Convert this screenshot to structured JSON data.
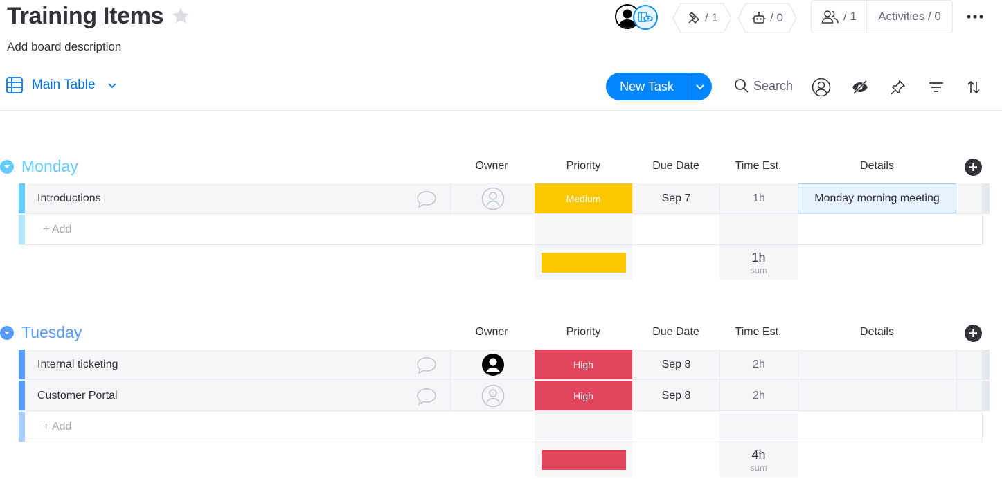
{
  "board": {
    "title": "Training Items",
    "description": "Add board description",
    "integrations_count": "/ 1",
    "automations_count": "/ 0",
    "members_count": "/ 1",
    "activities_label": "Activities / 0"
  },
  "toolbar": {
    "view_label": "Main Table",
    "new_task_label": "New Task",
    "search_label": "Search"
  },
  "columns": {
    "owner": "Owner",
    "priority": "Priority",
    "due_date": "Due Date",
    "time_est": "Time Est.",
    "details": "Details"
  },
  "groups": [
    {
      "name": "Monday",
      "color": "#66ccff",
      "items": [
        {
          "name": "Introductions",
          "owner": "none",
          "priority": "Medium",
          "priority_color": "#fdc700",
          "due": "Sep 7",
          "time": "1h",
          "details": "Monday morning meeting"
        }
      ],
      "add_label": "+ Add",
      "time_sum": "1h",
      "sum_label": "sum"
    },
    {
      "name": "Tuesday",
      "color": "#579bfc",
      "items": [
        {
          "name": "Internal ticketing",
          "owner": "assigned",
          "priority": "High",
          "priority_color": "#e2445c",
          "due": "Sep 8",
          "time": "2h",
          "details": ""
        },
        {
          "name": "Customer Portal",
          "owner": "none",
          "priority": "High",
          "priority_color": "#e2445c",
          "due": "Sep 8",
          "time": "2h",
          "details": ""
        }
      ],
      "add_label": "+ Add",
      "time_sum": "4h",
      "sum_label": "sum"
    }
  ]
}
